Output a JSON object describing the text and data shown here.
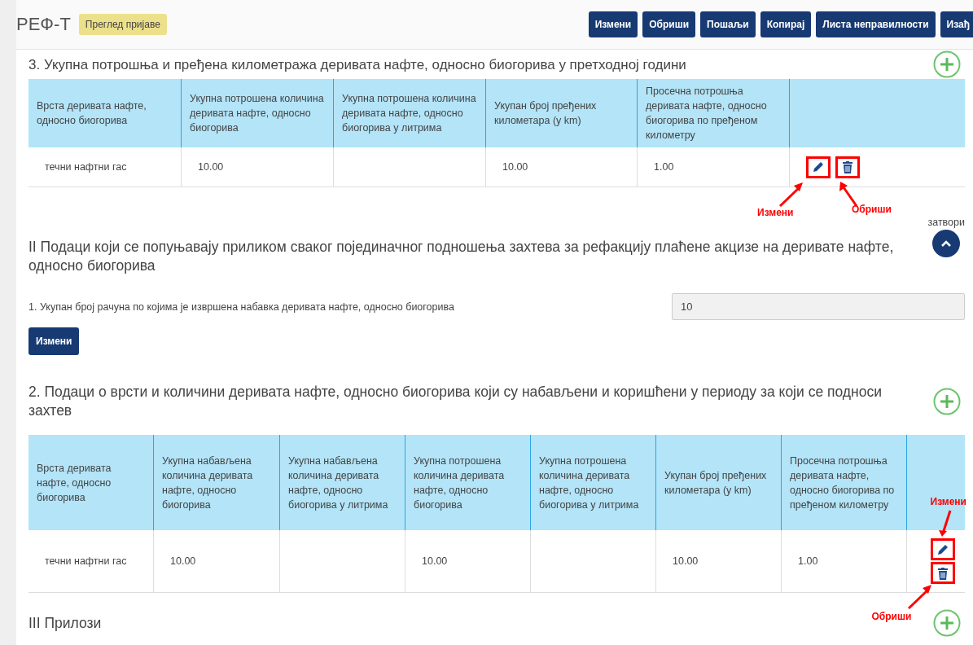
{
  "app": {
    "title": "РЕФ-Т",
    "badge": "Преглед пријаве"
  },
  "toolbar": [
    "Измени",
    "Обриши",
    "Пошаљи",
    "Копирај",
    "Листа неправилности",
    "Изађ"
  ],
  "part_1": {
    "heading": "3. Укупна потрошња и пређена километража деривата нафте, односно биогорива у претходној години",
    "table": {
      "columns": [
        "Врста деривата нафте, односно биогорива",
        "Укупна потрошена количина деривата нафте, односно биогорива",
        "Укупна потрошена количина деривата нафте, односно биогорива у литрима",
        "Укупан број пређених километара (у km)",
        "Просечна потрошња деривата нафте, односно биогорива по пређеном километру"
      ],
      "rows": [
        {
          "cells": [
            "течни нафтни гас",
            "10.00",
            null,
            "10.00",
            "1.00"
          ],
          "actions": [
            {
              "kind": "edit",
              "highlighted": true
            },
            {
              "kind": "delete",
              "highlighted": true
            }
          ]
        }
      ],
      "annotations": [
        {
          "kind": "edit",
          "label": "Измени"
        },
        {
          "kind": "delete",
          "label": "Обриши"
        }
      ]
    }
  },
  "part_2": {
    "heading": "II Подаци који се попуњавају приликом сваког појединачног подношења захтева за рефакцију плаћене акцизе на деривате нафте, односно биогорива",
    "toggle_label": "затвори",
    "expanded": true,
    "field": {
      "label": "1. Укупан број рачуна по којима је извршена набавка деривата нафте, односно биогорива",
      "value": "10"
    },
    "button": "Измени",
    "subheading": "2. Подаци о врсти и количини деривата нафте, односно биогорива који су набављени и коришћени у периоду за који се подноси захтев",
    "table": {
      "columns": [
        "Врста деривата нафте, односно биогорива",
        "Укупна набављена количина деривата нафте, односно биогорива",
        "Укупна набављена количина деривата нафте, односно биогорива у литрима",
        "Укупна потрошена количина деривата нафте, односно биогорива",
        "Укупна потрошена количина деривата нафте, односно биогорива у литрима",
        "Укупан број пређених километара (у km)",
        "Просечна потрошња деривата нафте, односно биогорива по пређеном километру"
      ],
      "rows": [
        {
          "cells": [
            "течни нафтни гас",
            "10.00",
            null,
            "10.00",
            null,
            "10.00",
            "1.00"
          ],
          "actions": [
            {
              "kind": "edit",
              "highlighted": true
            },
            {
              "kind": "delete",
              "highlighted": true
            }
          ]
        }
      ],
      "annotations": [
        {
          "kind": "edit",
          "label": "Измени"
        },
        {
          "kind": "delete",
          "label": "Обриши"
        }
      ]
    }
  },
  "part_3": {
    "heading": "III Прилози"
  }
}
